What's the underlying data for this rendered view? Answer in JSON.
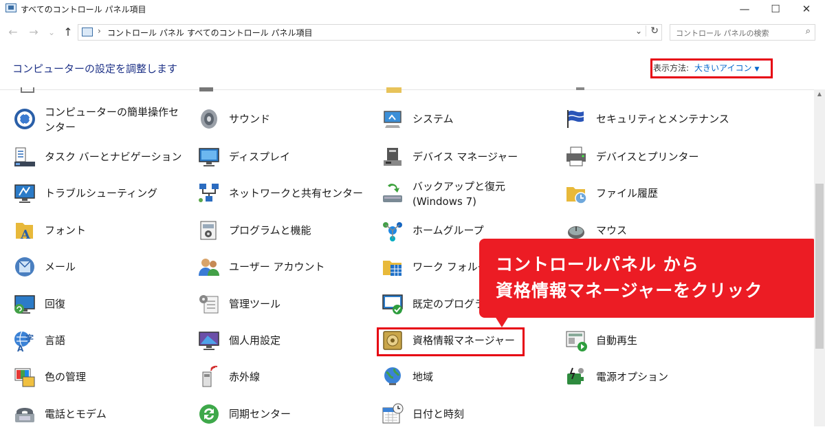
{
  "window": {
    "title": "すべてのコントロール パネル項目",
    "minimize": "—",
    "maximize": "☐",
    "close": "✕"
  },
  "nav": {
    "back": "←",
    "forward": "→",
    "recent": "⌄",
    "up": "↑"
  },
  "address": {
    "crumbs": [
      "コントロール パネル",
      "すべてのコントロール パネル項目"
    ],
    "sep": "›",
    "dropdown": "⌄",
    "refresh": "↻"
  },
  "search": {
    "placeholder": "コントロール パネルの検索",
    "icon": "⌕"
  },
  "header": {
    "title": "コンピューターの設定を調整します",
    "view_by_label": "表示方法:",
    "view_by_value": "大きいアイコン",
    "view_by_caret": "▼"
  },
  "items": [
    [
      "コンピューターの簡単操作センター",
      "サウンド",
      "システム",
      "セキュリティとメンテナンス"
    ],
    [
      "タスク バーとナビゲーション",
      "ディスプレイ",
      "デバイス マネージャー",
      "デバイスとプリンター"
    ],
    [
      "トラブルシューティング",
      "ネットワークと共有センター",
      "バックアップと復元 (Windows 7)",
      "ファイル履歴"
    ],
    [
      "フォント",
      "プログラムと機能",
      "ホームグループ",
      "マウス"
    ],
    [
      "メール",
      "ユーザー アカウント",
      "ワーク フォルダー",
      ""
    ],
    [
      "回復",
      "管理ツール",
      "既定のプログラム",
      ""
    ],
    [
      "言語",
      "個人用設定",
      "資格情報マネージャー",
      "自動再生"
    ],
    [
      "色の管理",
      "赤外線",
      "地域",
      "電源オプション"
    ],
    [
      "電話とモデム",
      "同期センター",
      "日付と時刻",
      ""
    ]
  ],
  "callout": {
    "line1": "コントロールパネル から",
    "line2": "資格情報マネージャーをクリック"
  },
  "colors": {
    "accent_red": "#e60012",
    "link_blue": "#0066cc",
    "heading_blue": "#1e3287"
  }
}
